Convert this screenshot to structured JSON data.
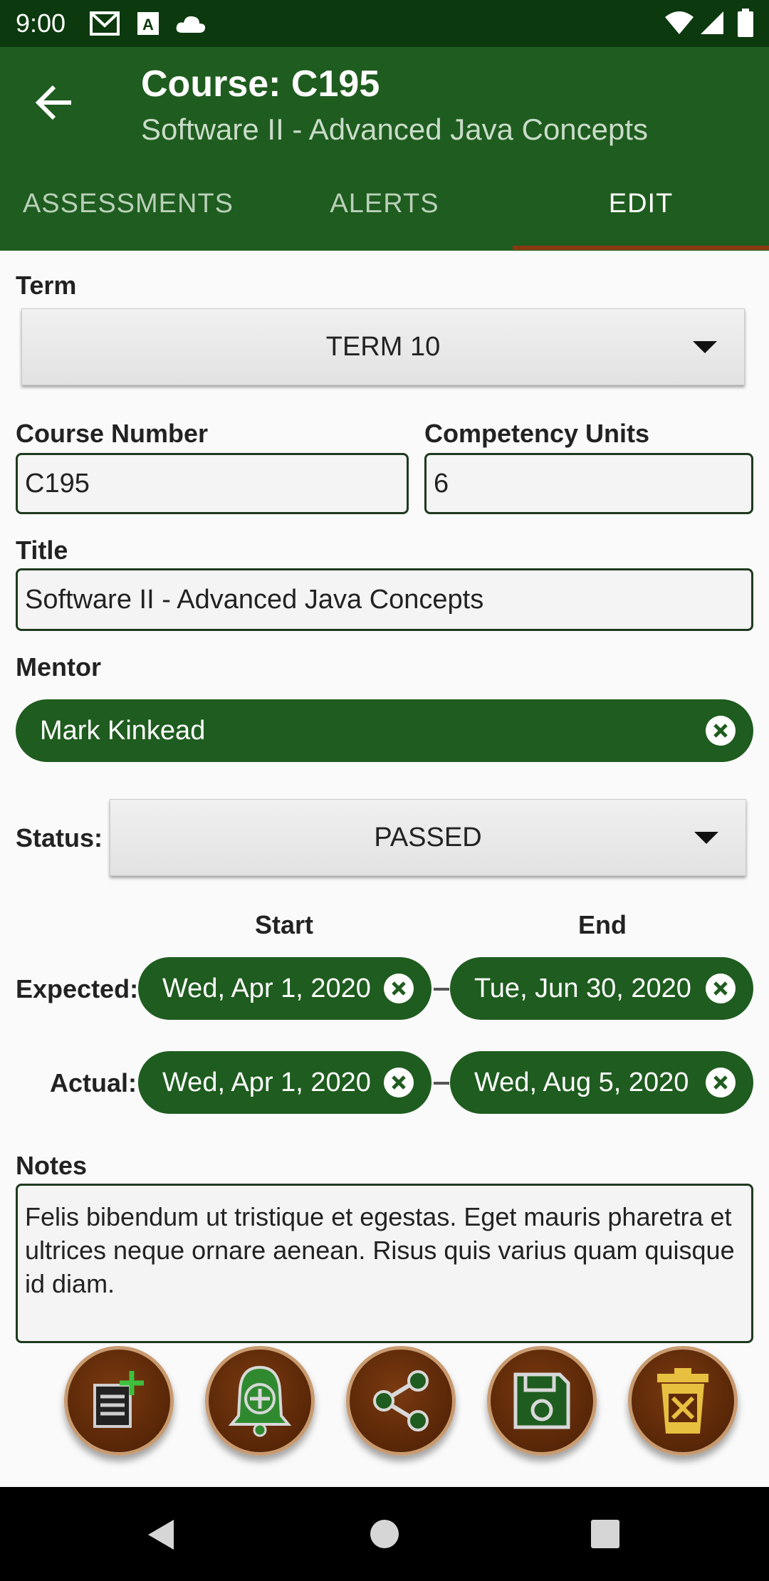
{
  "status_bar": {
    "time": "9:00",
    "icons": [
      "gmail-icon",
      "font-icon",
      "cloud-icon",
      "wifi-icon",
      "signal-icon",
      "battery-icon"
    ]
  },
  "app_bar": {
    "title": "Course: C195",
    "subtitle": "Software II - Advanced Java Concepts"
  },
  "tabs": [
    {
      "label": "ASSESSMENTS",
      "active": false
    },
    {
      "label": "ALERTS",
      "active": false
    },
    {
      "label": "EDIT",
      "active": true
    }
  ],
  "form": {
    "term_label": "Term",
    "term_value": "TERM 10",
    "course_number_label": "Course Number",
    "course_number_value": "C195",
    "competency_units_label": "Competency Units",
    "competency_units_value": "6",
    "title_label": "Title",
    "title_value": "Software II - Advanced Java Concepts",
    "mentor_label": "Mentor",
    "mentor_value": "Mark Kinkead",
    "status_label": "Status:",
    "status_value": "PASSED",
    "start_header": "Start",
    "end_header": "End",
    "expected_label": "Expected:",
    "expected_start": "Wed, Apr 1, 2020",
    "expected_end": "Tue, Jun 30, 2020",
    "actual_label": "Actual:",
    "actual_start": "Wed, Apr 1, 2020",
    "actual_end": "Wed, Aug 5, 2020",
    "notes_label": "Notes",
    "notes_value": " Felis bibendum ut tristique et egestas. Eget mauris pharetra et ultrices neque ornare aenean. Risus quis varius quam quisque id diam."
  },
  "actions": [
    "add-assessment-icon",
    "add-alert-icon",
    "share-icon",
    "save-icon",
    "delete-icon"
  ],
  "colors": {
    "primary": "#1f5c1f",
    "status_bar": "#0c3a0e",
    "accent": "#8a3a10",
    "fab": "#5e2a08"
  }
}
